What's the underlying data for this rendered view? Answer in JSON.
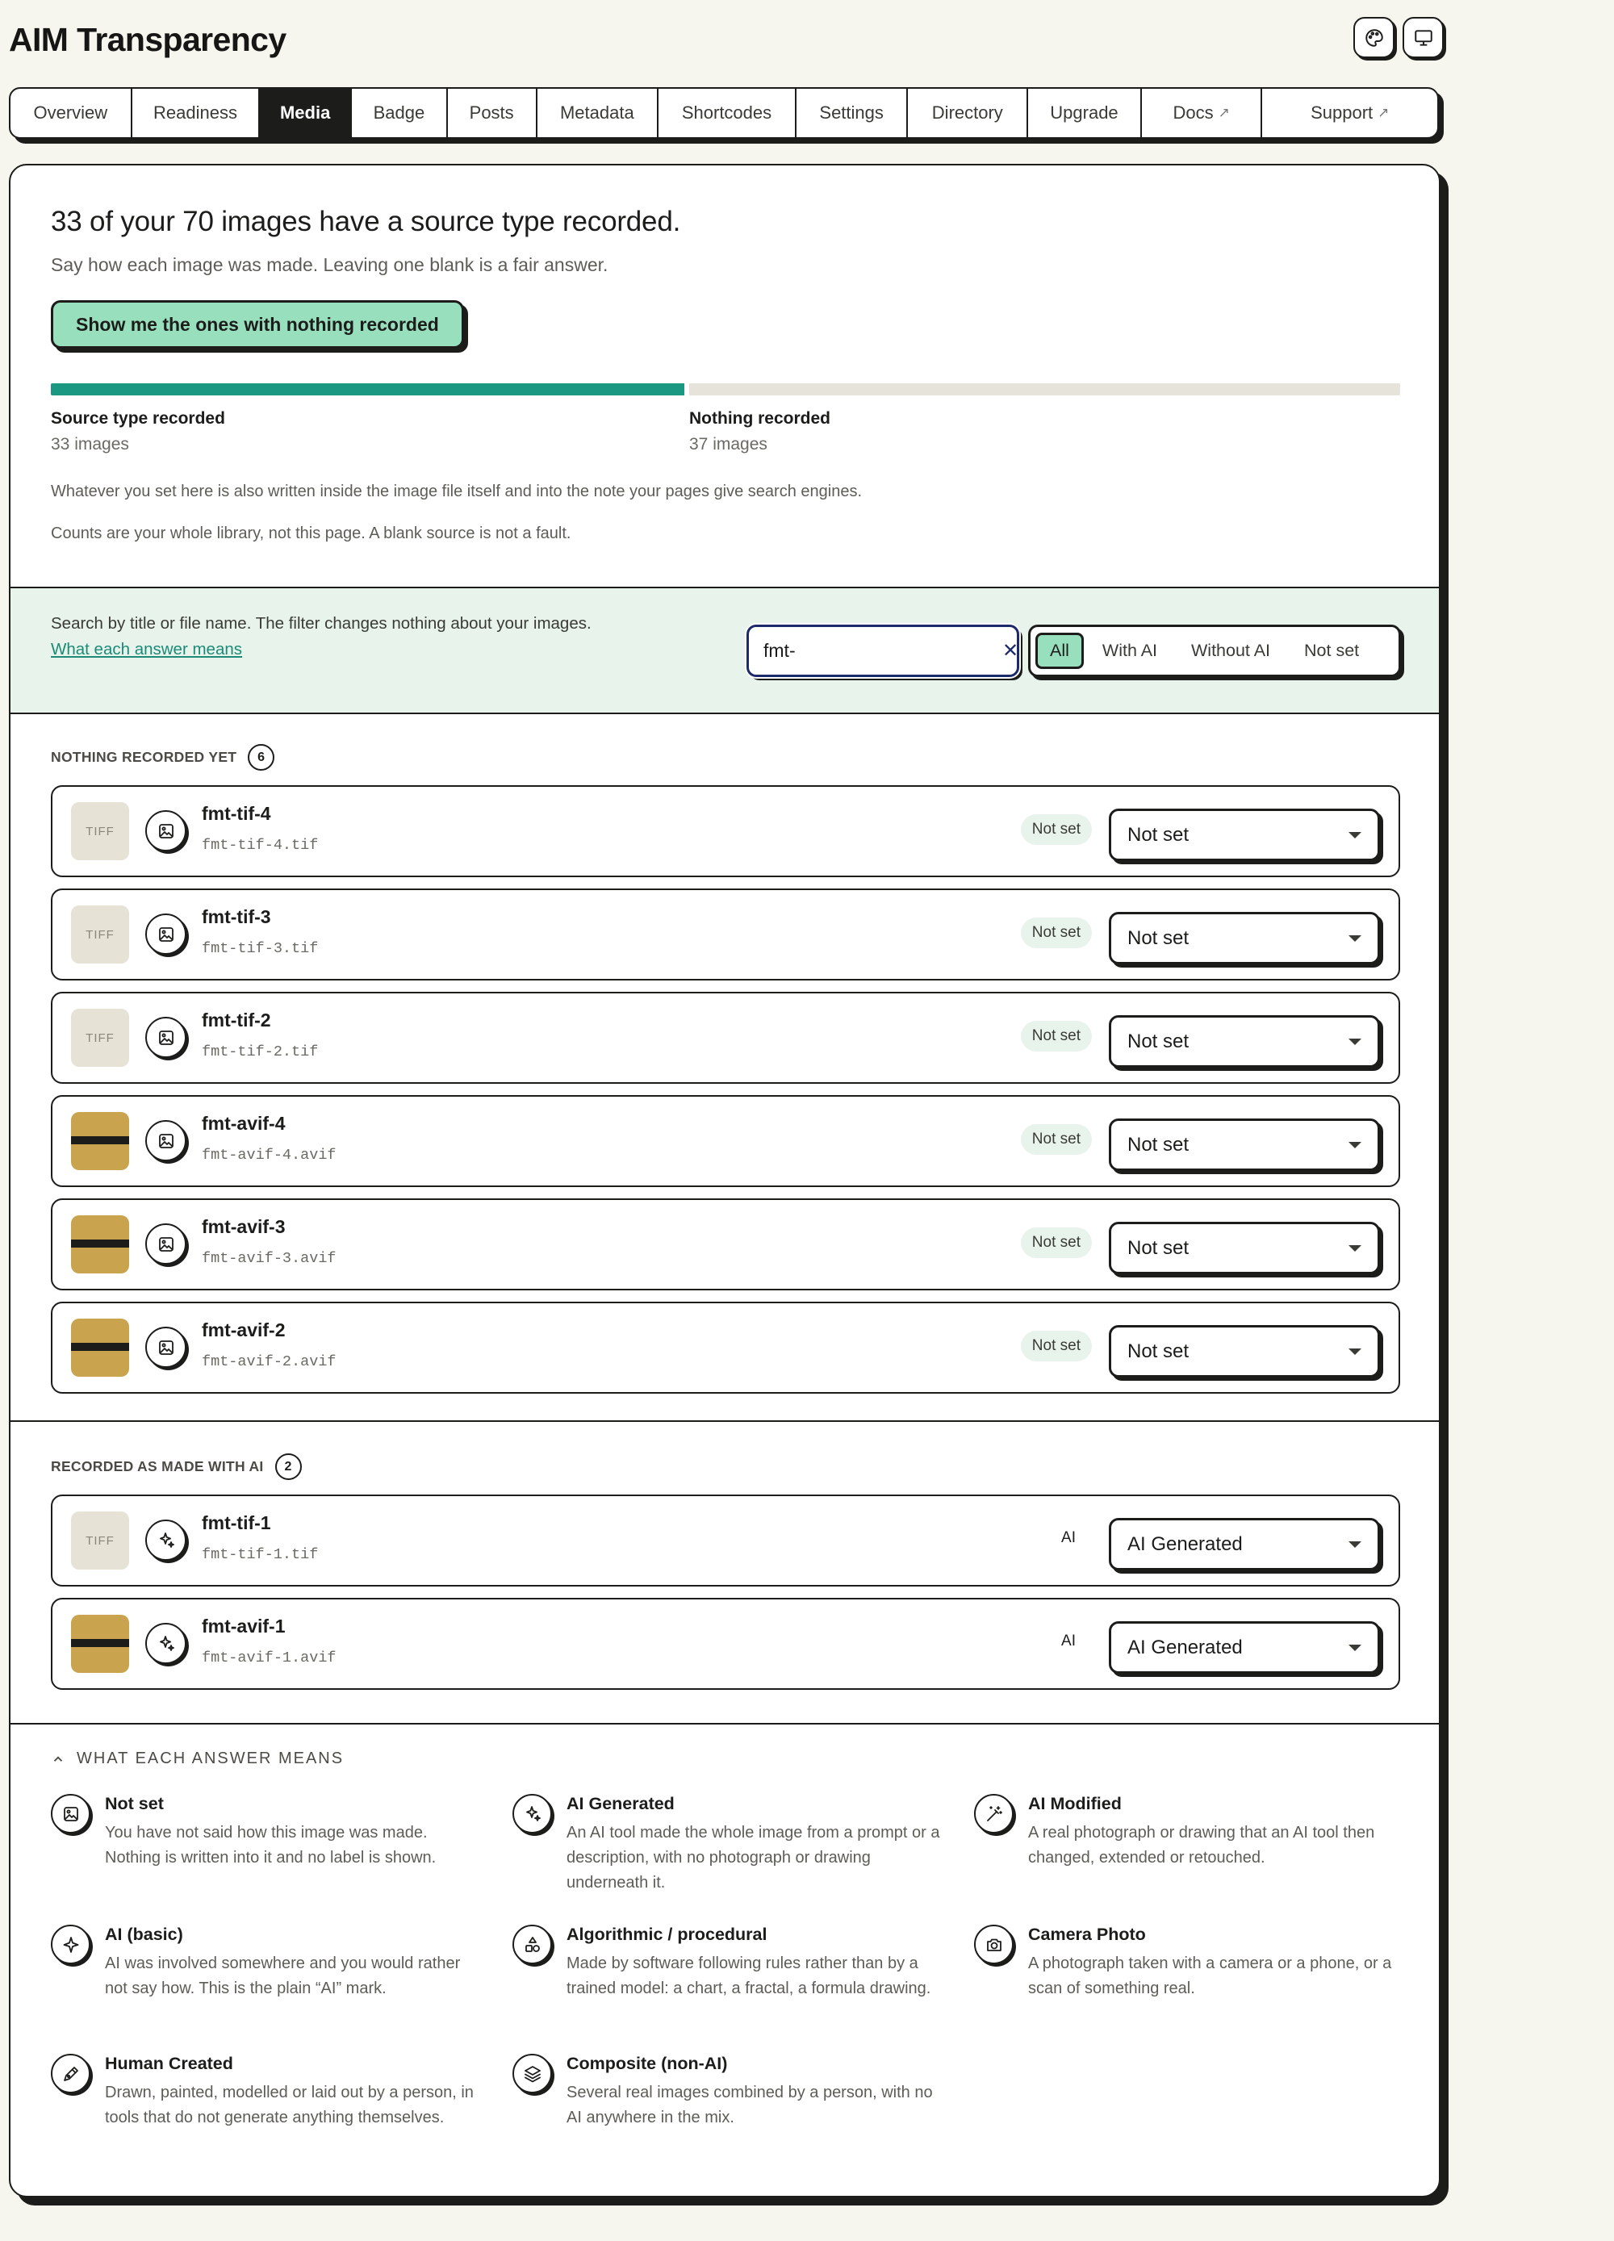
{
  "app": {
    "title": "AIM Transparency",
    "palette_icon": "palette-icon",
    "monitor_icon": "monitor-icon"
  },
  "tabs": [
    {
      "label": "Overview"
    },
    {
      "label": "Readiness"
    },
    {
      "label": "Media",
      "active": true
    },
    {
      "label": "Badge"
    },
    {
      "label": "Posts"
    },
    {
      "label": "Metadata"
    },
    {
      "label": "Shortcodes"
    },
    {
      "label": "Settings"
    },
    {
      "label": "Directory"
    },
    {
      "label": "Upgrade"
    },
    {
      "label": "Docs",
      "external": "↗"
    },
    {
      "label": "Support",
      "external": "↗"
    }
  ],
  "summary": {
    "headline": "33 of your 70 images have a source type recorded.",
    "subline": "Say how each image was made. Leaving one blank is a fair answer.",
    "cta_label": "Show me the ones with nothing recorded",
    "recorded_fraction": 0.4714,
    "recorded_label": "Source type recorded",
    "recorded_count": "33 images",
    "unrecorded_label": "Nothing recorded",
    "unrecorded_count": "37 images",
    "note_1": "Whatever you set here is also written inside the image file itself and into the note your pages give search engines.",
    "note_2": "Counts are your whole library, not this page. A blank source is not a fault."
  },
  "filter": {
    "help_text": "Search by title or file name. The filter changes nothing about your images.",
    "help_link": "What each answer means",
    "search_value": "fmt-",
    "clear_icon": "close-icon",
    "segments": [
      "All",
      "With AI",
      "Without AI",
      "Not set"
    ],
    "active_segment": "All"
  },
  "sections": {
    "unrecorded": {
      "label": "NOTHING RECORDED YET",
      "count": "6"
    },
    "ai": {
      "label": "RECORDED AS MADE WITH AI",
      "count": "2"
    }
  },
  "rows_unrecorded": [
    {
      "title": "fmt-tif-4",
      "file": "fmt-tif-4.tif",
      "thumb": "TIFF",
      "pill": "Not set",
      "select": "Not set"
    },
    {
      "title": "fmt-tif-3",
      "file": "fmt-tif-3.tif",
      "thumb": "TIFF",
      "pill": "Not set",
      "select": "Not set"
    },
    {
      "title": "fmt-tif-2",
      "file": "fmt-tif-2.tif",
      "thumb": "TIFF",
      "pill": "Not set",
      "select": "Not set"
    },
    {
      "title": "fmt-avif-4",
      "file": "fmt-avif-4.avif",
      "thumb": "",
      "pill": "Not set",
      "select": "Not set"
    },
    {
      "title": "fmt-avif-3",
      "file": "fmt-avif-3.avif",
      "thumb": "",
      "pill": "Not set",
      "select": "Not set"
    },
    {
      "title": "fmt-avif-2",
      "file": "fmt-avif-2.avif",
      "thumb": "",
      "pill": "Not set",
      "select": "Not set"
    }
  ],
  "rows_ai": [
    {
      "title": "fmt-tif-1",
      "file": "fmt-tif-1.tif",
      "thumb": "TIFF",
      "label": "AI",
      "select": "AI Generated"
    },
    {
      "title": "fmt-avif-1",
      "file": "fmt-avif-1.avif",
      "thumb": "",
      "label": "AI",
      "select": "AI Generated"
    }
  ],
  "glossary": {
    "heading": "WHAT EACH ANSWER MEANS",
    "items": [
      {
        "title": "Not set",
        "desc": "You have not said how this image was made. Nothing is written into it and no label is shown.",
        "icon": "image-icon"
      },
      {
        "title": "AI Generated",
        "desc": "An AI tool made the whole image from a prompt or a description, with no photograph or drawing underneath it.",
        "icon": "sparkles-icon"
      },
      {
        "title": "AI Modified",
        "desc": "A real photograph or drawing that an AI tool then changed, extended or retouched.",
        "icon": "magic-wand-icon"
      },
      {
        "title": "AI (basic)",
        "desc": "AI was involved somewhere and you would rather not say how. This is the plain “AI” mark.",
        "icon": "sparkle-icon"
      },
      {
        "title": "Algorithmic / procedural",
        "desc": "Made by software following rules rather than by a trained model: a chart, a fractal, a formula drawing.",
        "icon": "shapes-icon"
      },
      {
        "title": "Camera Photo",
        "desc": "A photograph taken with a camera or a phone, or a scan of something real.",
        "icon": "camera-icon"
      },
      {
        "title": "Human Created",
        "desc": "Drawn, painted, modelled or laid out by a person, in tools that do not generate anything themselves.",
        "icon": "pen-icon"
      },
      {
        "title": "Composite (non-AI)",
        "desc": "Several real images combined by a person, with no AI anywhere in the mix.",
        "icon": "layers-icon"
      }
    ]
  }
}
